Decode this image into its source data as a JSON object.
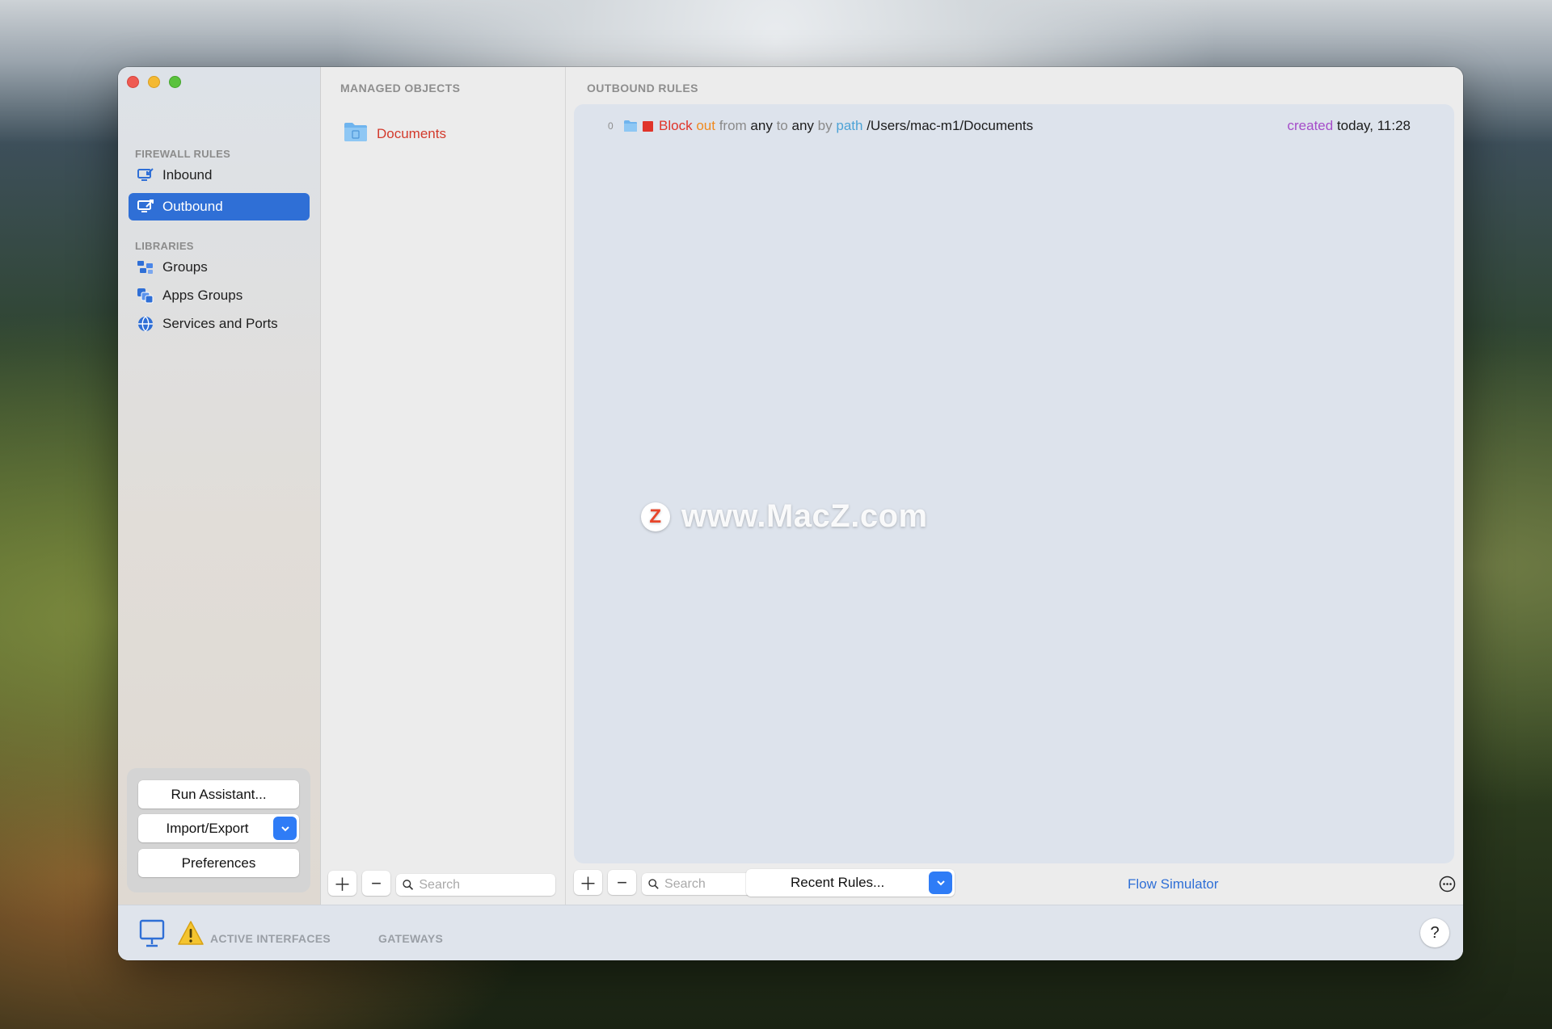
{
  "sidebar": {
    "firewall_header": "FIREWALL RULES",
    "libraries_header": "LIBRARIES",
    "items": [
      {
        "label": "Inbound",
        "icon": "inbound-icon"
      },
      {
        "label": "Outbound",
        "icon": "outbound-icon",
        "selected": true
      },
      {
        "label": "Groups",
        "icon": "groups-icon"
      },
      {
        "label": "Apps Groups",
        "icon": "apps-groups-icon"
      },
      {
        "label": "Services and Ports",
        "icon": "services-globe-icon"
      }
    ],
    "buttons": {
      "run_assistant": "Run Assistant...",
      "import_export": "Import/Export",
      "preferences": "Preferences"
    }
  },
  "managed_objects": {
    "title": "MANAGED OBJECTS",
    "items": [
      {
        "label": "Documents",
        "icon": "folder-icon"
      }
    ],
    "search_placeholder": "Search"
  },
  "outbound_rules": {
    "title": "OUTBOUND RULES",
    "rules": [
      {
        "index": "0",
        "action": "Block",
        "direction": "out",
        "from_kw": "from",
        "from_val": "any",
        "to_kw": "to",
        "to_val": "any",
        "by_kw": "by",
        "type": "path",
        "path": "/Users/mac-m1/Documents",
        "created_kw": "created",
        "created_val": "today, 11:28"
      }
    ],
    "search_placeholder": "Search",
    "recent_rules": "Recent Rules...",
    "flow_simulator": "Flow Simulator"
  },
  "statusbar": {
    "active_interfaces": "ACTIVE INTERFACES",
    "gateways": "GATEWAYS",
    "help": "?"
  },
  "watermark": {
    "logo_letter": "Z",
    "text": "www.MacZ.com"
  },
  "colors": {
    "accent": "#2f6fd6",
    "block_red": "#e0342a",
    "direction_orange": "#f08a1f",
    "path_blue": "#4ea3d6",
    "created_purple": "#a54cc9"
  }
}
